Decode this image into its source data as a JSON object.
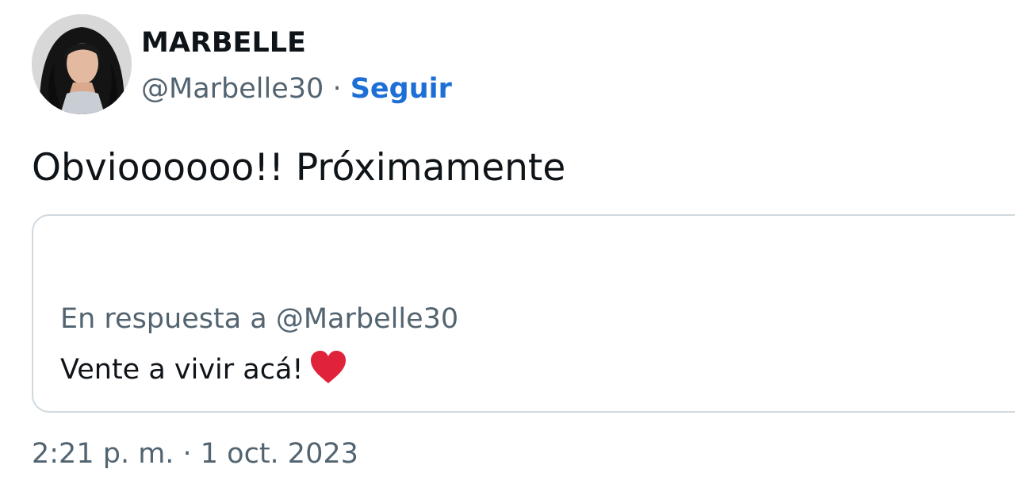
{
  "author": {
    "display_name": "MARBELLE",
    "handle": "@Marbelle30",
    "separator": " · ",
    "follow_label": "Seguir",
    "avatar_icon": "profile-photo"
  },
  "tweet": {
    "text": "Obvioooooo!! Próximamente",
    "timestamp": "2:21 p. m. · 1 oct. 2023"
  },
  "quoted_tweet": {
    "reply_context": "En respuesta a @Marbelle30",
    "text": "Vente a vivir acá!",
    "emoji_icon": "red-heart-icon"
  },
  "colors": {
    "accent": "#1d6fd6",
    "secondary_text": "#536471",
    "border": "#cfd9de",
    "heart": "#e0233a"
  }
}
